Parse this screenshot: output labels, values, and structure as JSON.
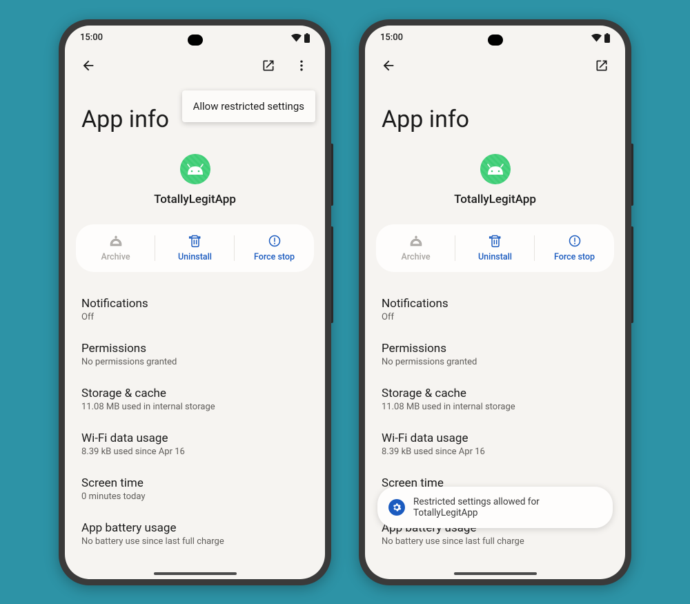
{
  "status": {
    "time": "15:00"
  },
  "menu": {
    "allow_restricted": "Allow restricted settings"
  },
  "page_title": "App info",
  "app": {
    "name": "TotallyLegitApp"
  },
  "actions": {
    "archive": "Archive",
    "uninstall": "Uninstall",
    "forcestop": "Force stop"
  },
  "settings": {
    "notifications": {
      "title": "Notifications",
      "sub": "Off"
    },
    "permissions": {
      "title": "Permissions",
      "sub": "No permissions granted"
    },
    "storage": {
      "title": "Storage & cache",
      "sub": "11.08 MB used in internal storage"
    },
    "wifi": {
      "title": "Wi-Fi data usage",
      "sub": "8.39 kB used since Apr 16"
    },
    "screentime": {
      "title": "Screen time",
      "sub": "0 minutes today"
    },
    "battery": {
      "title": "App battery usage",
      "sub": "No battery use since last full charge"
    }
  },
  "snackbar": {
    "text": "Restricted settings allowed for TotallyLegitApp"
  }
}
